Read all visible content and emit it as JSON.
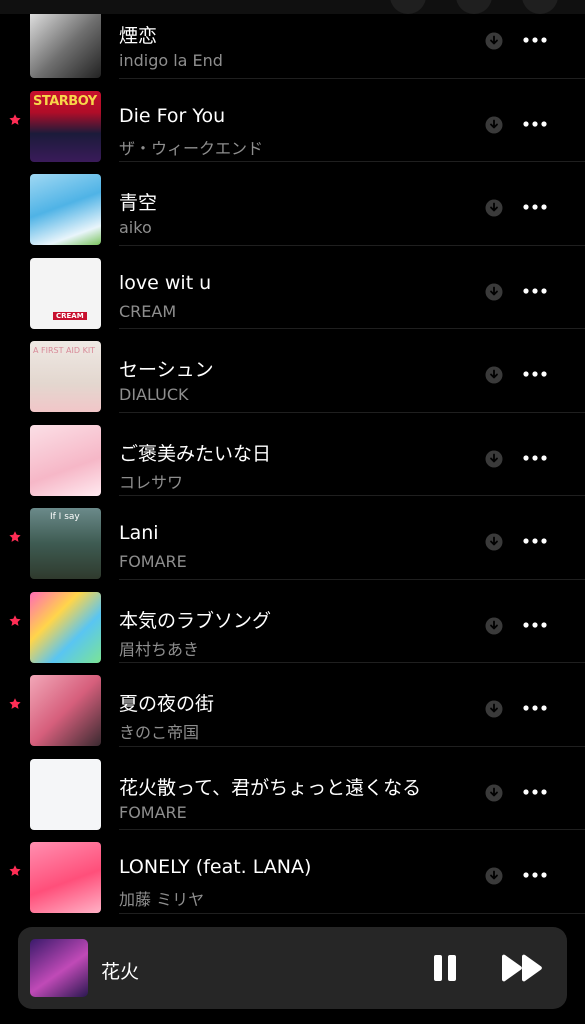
{
  "songs": [
    {
      "title": "煙恋",
      "artist": "indigo la End",
      "starred": false,
      "art": "a0"
    },
    {
      "title": "Die For You",
      "artist": "ザ・ウィークエンド",
      "starred": true,
      "art": "a1",
      "art_text": "STARBOY"
    },
    {
      "title": "青空",
      "artist": "aiko",
      "starred": false,
      "art": "a2"
    },
    {
      "title": "love wit u",
      "artist": "CREAM",
      "starred": false,
      "art": "a3",
      "art_text": "CREAM"
    },
    {
      "title": "セーシュン",
      "artist": "DIALUCK",
      "starred": false,
      "art": "a4",
      "art_text": "A FIRST AID KIT"
    },
    {
      "title": "ご褒美みたいな日",
      "artist": "コレサワ",
      "starred": false,
      "art": "a5"
    },
    {
      "title": "Lani",
      "artist": "FOMARE",
      "starred": true,
      "art": "a6",
      "art_text": "If I say"
    },
    {
      "title": "本気のラブソング",
      "artist": "眉村ちあき",
      "starred": true,
      "art": "a7"
    },
    {
      "title": "夏の夜の街",
      "artist": "きのこ帝国",
      "starred": true,
      "art": "a8"
    },
    {
      "title": "花火散って、君がちょっと遠くなる",
      "artist": "FOMARE",
      "starred": false,
      "art": "a9"
    },
    {
      "title": "LONELY (feat. LANA)",
      "artist": "加藤 ミリヤ",
      "starred": true,
      "art": "a10"
    }
  ],
  "icons": {
    "star": "star-icon",
    "download": "download-icon",
    "more": "more-icon",
    "pause": "pause-icon",
    "forward": "fast-forward-icon"
  },
  "colors": {
    "accent": "#ff2d55",
    "secondary_text": "#8e8e8e",
    "background": "#000000",
    "player": "#262626"
  },
  "now_playing": {
    "title": "花火"
  }
}
